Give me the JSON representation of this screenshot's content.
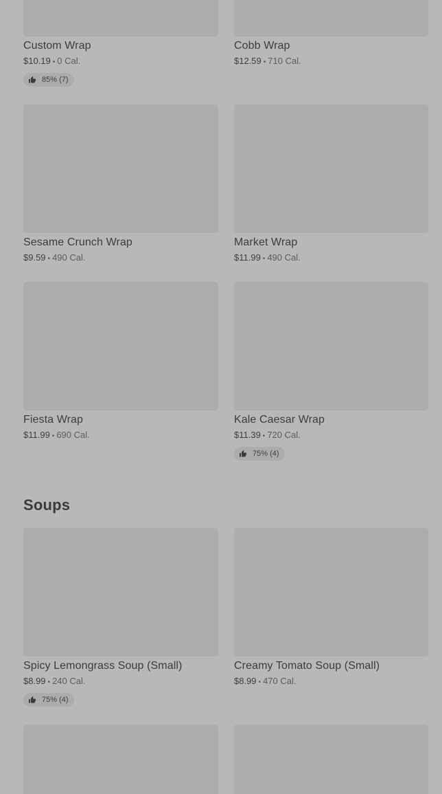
{
  "wraps": [
    {
      "name": "Custom Wrap",
      "price": "$10.19",
      "calories": "0 Cal.",
      "rating": "85% (7)"
    },
    {
      "name": "Cobb Wrap",
      "price": "$12.59",
      "calories": "710 Cal."
    },
    {
      "name": "Sesame Crunch Wrap",
      "price": "$9.59",
      "calories": "490 Cal."
    },
    {
      "name": "Market Wrap",
      "price": "$11.99",
      "calories": "490 Cal."
    },
    {
      "name": "Fiesta Wrap",
      "price": "$11.99",
      "calories": "690 Cal."
    },
    {
      "name": "Kale Caesar Wrap",
      "price": "$11.39",
      "calories": "720 Cal.",
      "rating": "75% (4)"
    }
  ],
  "soups_section": {
    "title": "Soups",
    "items": [
      {
        "name": "Spicy Lemongrass Soup (Small)",
        "price": "$8.99",
        "calories": "240 Cal.",
        "rating": "75% (4)"
      },
      {
        "name": "Creamy Tomato Soup (Small)",
        "price": "$8.99",
        "calories": "470 Cal."
      }
    ]
  },
  "separator": "•",
  "icons": {
    "rating": "thumbs-up-icon"
  }
}
